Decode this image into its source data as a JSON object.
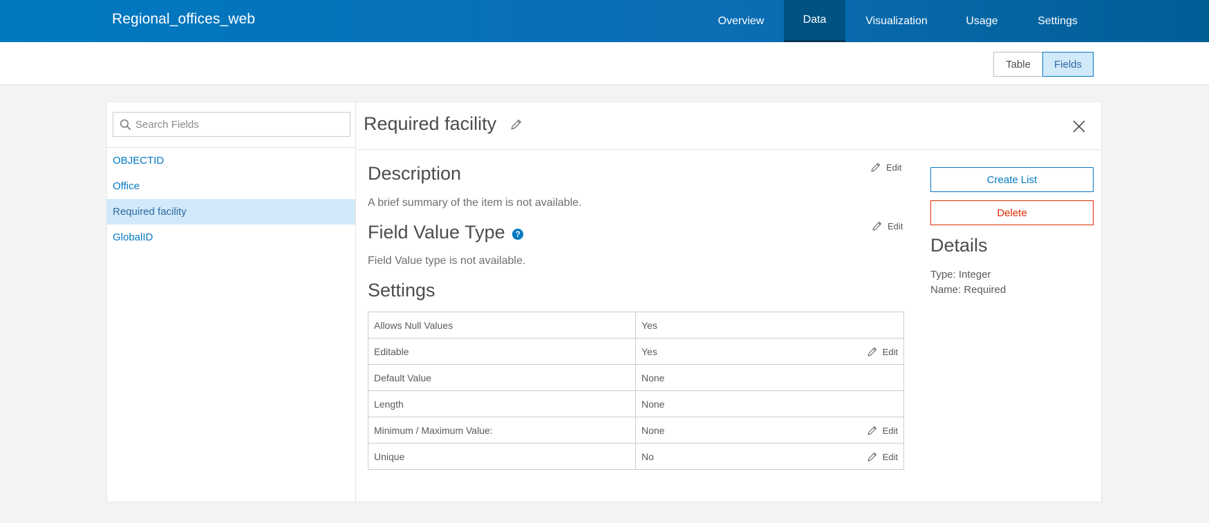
{
  "app": {
    "title": "Regional_offices_web"
  },
  "nav": {
    "tabs": [
      {
        "label": "Overview"
      },
      {
        "label": "Data"
      },
      {
        "label": "Visualization"
      },
      {
        "label": "Usage"
      },
      {
        "label": "Settings"
      }
    ],
    "active": "Data"
  },
  "view_toggle": {
    "table_label": "Table",
    "fields_label": "Fields",
    "active": "Fields"
  },
  "sidebar": {
    "search_placeholder": "Search Fields",
    "fields": [
      {
        "label": "OBJECTID"
      },
      {
        "label": "Office"
      },
      {
        "label": "Required facility"
      },
      {
        "label": "GlobalID"
      }
    ],
    "selected": "Required facility"
  },
  "detail": {
    "title": "Required facility",
    "description": {
      "heading": "Description",
      "text": "A brief summary of the item is not available.",
      "edit_label": "Edit"
    },
    "field_value_type": {
      "heading": "Field Value Type",
      "text": "Field Value type is not available.",
      "edit_label": "Edit",
      "help_glyph": "?"
    },
    "settings": {
      "heading": "Settings",
      "rows": [
        {
          "name": "Allows Null Values",
          "value": "Yes",
          "edit": ""
        },
        {
          "name": "Editable",
          "value": "Yes",
          "edit": "Edit"
        },
        {
          "name": "Default Value",
          "value": "None",
          "edit": ""
        },
        {
          "name": "Length",
          "value": "None",
          "edit": ""
        },
        {
          "name": "Minimum / Maximum Value:",
          "value": "None",
          "edit": "Edit"
        },
        {
          "name": "Unique",
          "value": "No",
          "edit": "Edit"
        }
      ]
    }
  },
  "actions": {
    "create_list_label": "Create List",
    "delete_label": "Delete"
  },
  "details_panel": {
    "heading": "Details",
    "type_line": "Type: Integer",
    "name_line": "Name: Required"
  },
  "icons": {
    "search": "search-icon",
    "pencil": "pencil-icon",
    "close": "close-icon",
    "help": "help-icon"
  },
  "colors": {
    "brand_blue": "#0079c1",
    "nav_active": "#005283",
    "selected_bg": "#d2e9f9",
    "danger": "#de2900"
  }
}
